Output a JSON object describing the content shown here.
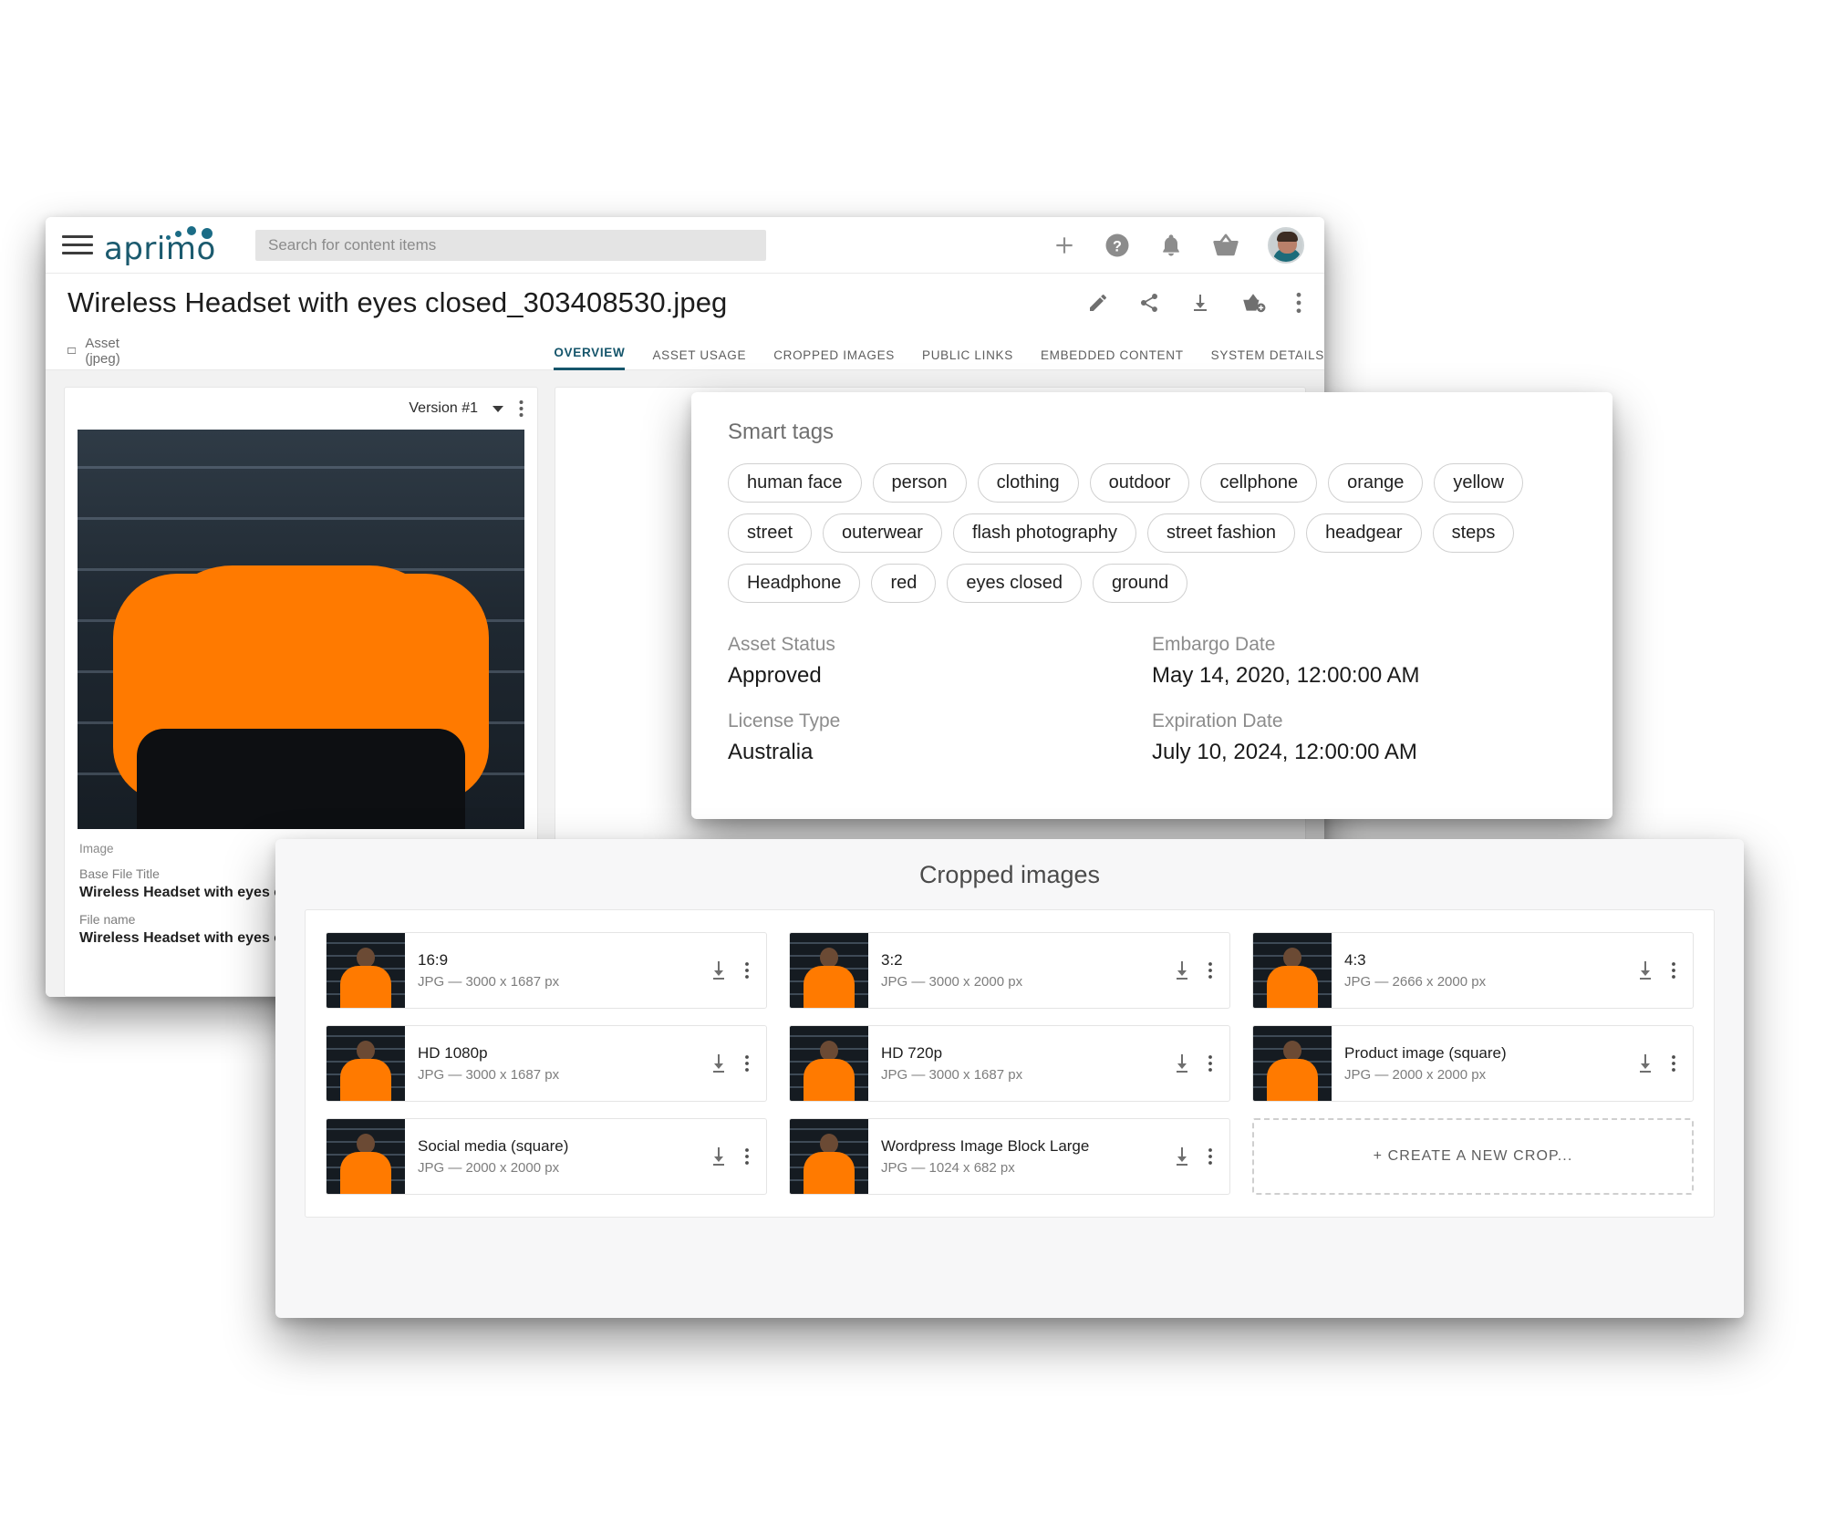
{
  "app": {
    "brand": "aprimo",
    "search_placeholder": "Search for content items",
    "icons": {
      "menu": "hamburger-menu-icon",
      "add": "plus-icon",
      "help": "help-circle-icon",
      "notifications": "bell-icon",
      "basket": "basket-icon",
      "avatar": "user-avatar"
    }
  },
  "asset": {
    "title": "Wireless Headset with eyes closed_303408530.jpeg",
    "breadcrumb": "Asset (jpeg)",
    "version_label": "Version #1",
    "actions": [
      "edit-icon",
      "share-icon",
      "download-icon",
      "add-to-basket-icon",
      "more-vertical-icon"
    ]
  },
  "tabs": [
    {
      "label": "OVERVIEW",
      "active": true
    },
    {
      "label": "ASSET USAGE",
      "active": false
    },
    {
      "label": "CROPPED IMAGES",
      "active": false
    },
    {
      "label": "PUBLIC LINKS",
      "active": false
    },
    {
      "label": "EMBEDDED CONTENT",
      "active": false
    },
    {
      "label": "SYSTEM DETAILS",
      "active": false
    }
  ],
  "left_panel": {
    "section_label": "Image",
    "fields": [
      {
        "label": "Base File Title",
        "value": "Wireless Headset with eyes closed"
      },
      {
        "label": "File name",
        "value": "Wireless Headset with eyes closed"
      }
    ]
  },
  "smart_tags": {
    "heading": "Smart tags",
    "rows": [
      [
        "human face",
        "person",
        "clothing",
        "outdoor",
        "cellphone",
        "orange",
        "yellow"
      ],
      [
        "street",
        "outerwear",
        "flash photography",
        "street fashion",
        "headgear",
        "steps"
      ],
      [
        "Headphone",
        "red",
        "eyes closed",
        "ground"
      ]
    ]
  },
  "metadata": [
    {
      "label": "Asset Status",
      "value": "Approved"
    },
    {
      "label": "Embargo Date",
      "value": "May 14, 2020, 12:00:00 AM"
    },
    {
      "label": "License Type",
      "value": "Australia"
    },
    {
      "label": "Expiration Date",
      "value": "July 10, 2024, 12:00:00 AM"
    }
  ],
  "cropped_images": {
    "title": "Cropped images",
    "items": [
      {
        "name": "16:9",
        "spec": "JPG — 3000 x 1687 px"
      },
      {
        "name": "3:2",
        "spec": "JPG — 3000 x 2000 px"
      },
      {
        "name": "4:3",
        "spec": "JPG — 2666 x 2000 px"
      },
      {
        "name": "HD 1080p",
        "spec": "JPG — 3000 x 1687 px"
      },
      {
        "name": "HD 720p",
        "spec": "JPG — 3000 x 1687 px"
      },
      {
        "name": "Product image (square)",
        "spec": "JPG — 2000 x 2000 px"
      },
      {
        "name": "Social media (square)",
        "spec": "JPG — 2000 x 2000 px"
      },
      {
        "name": "Wordpress Image Block Large",
        "spec": "JPG — 1024 x 682 px"
      }
    ],
    "create_label": "+ CREATE A NEW CROP..."
  },
  "colors": {
    "brand_teal": "#1b5a6e",
    "tab_active": "#15556b",
    "accent_orange": "#ff7a00",
    "panel_bg": "#f2f2f2"
  }
}
